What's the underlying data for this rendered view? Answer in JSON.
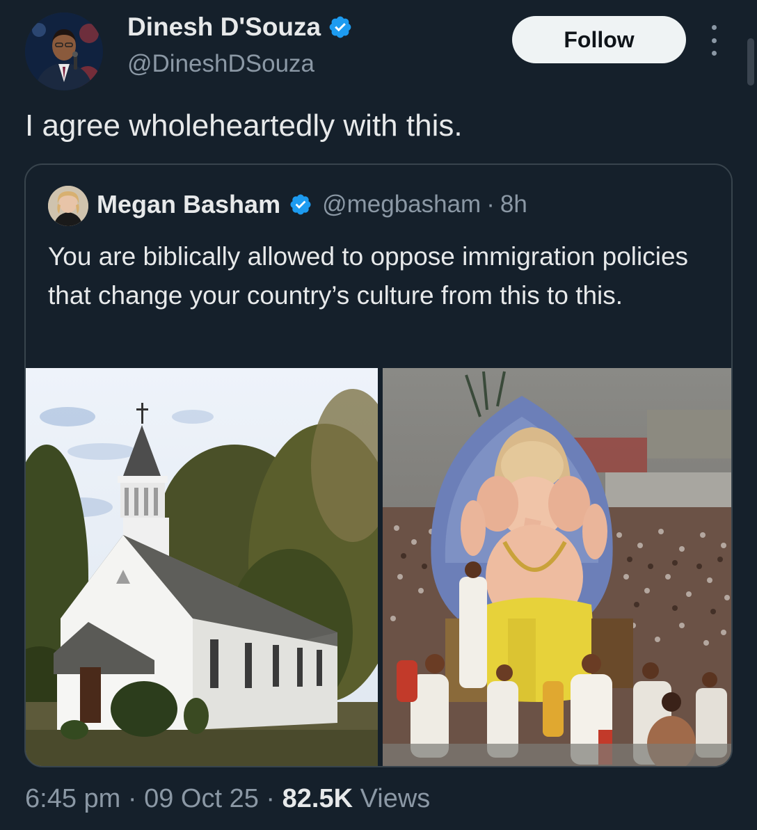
{
  "author": {
    "name": "Dinesh D'Souza",
    "handle": "@DineshDSouza",
    "verified": true
  },
  "follow_label": "Follow",
  "tweet_text": "I agree wholeheartedly with this.",
  "quoted": {
    "name": "Megan Basham",
    "handle": "@megbasham",
    "separator": "·",
    "time": "8h",
    "text": "You are biblically allowed to oppose immigration policies that change your country’s culture from this to this."
  },
  "footer": {
    "time": "6:45 pm",
    "sep1": "·",
    "date": "09 Oct 25",
    "sep2": "·",
    "views_count": "82.5K",
    "views_label": "Views"
  },
  "colors": {
    "background": "#15202b",
    "verified_blue": "#1d9bf0",
    "muted_text": "#8b98a5",
    "follow_button_bg": "#eff3f4"
  },
  "icons": {
    "verified": "verified-badge-icon",
    "more": "more-options-icon"
  }
}
